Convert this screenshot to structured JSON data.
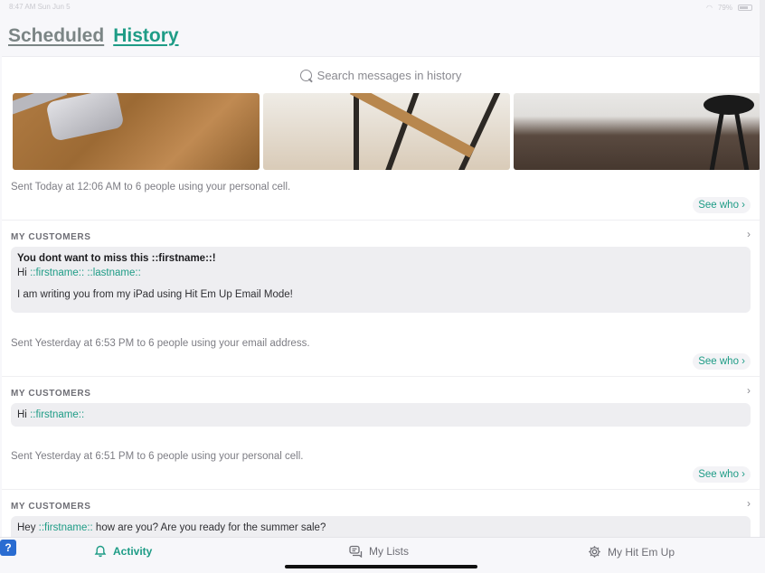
{
  "status_bar": {
    "time": "8:47 AM",
    "date": "Sun Jun 5",
    "battery": "79%"
  },
  "header": {
    "scheduled_label": "Scheduled",
    "history_label": "History"
  },
  "search": {
    "placeholder": "Search messages in history"
  },
  "entries": [
    {
      "sent": "Sent Today at 12:06 AM to 6 people using your personal cell.",
      "see_who": "See who ›"
    },
    {
      "list": "MY CUSTOMERS",
      "subject": "You dont want to miss this ::firstname::!",
      "greeting_prefix": "Hi ",
      "greeting_tags": "::firstname:: ::lastname::",
      "body": "I am writing you from my iPad using Hit Em Up Email Mode!",
      "sent": "Sent Yesterday at 6:53 PM to 6 people using your email address.",
      "see_who": "See who ›"
    },
    {
      "list": "MY CUSTOMERS",
      "greeting_prefix": "Hi ",
      "greeting_tags": "::firstname::",
      "sent": "Sent Yesterday at 6:51 PM to 6 people using your personal cell.",
      "see_who": "See who ›"
    },
    {
      "list": "MY CUSTOMERS",
      "greeting_prefix": "Hey ",
      "greeting_tags": "::firstname::",
      "greeting_suffix": " how are you? Are you ready for the summer sale?"
    }
  ],
  "tabbar": {
    "activity": "Activity",
    "my_lists": "My Lists",
    "my_hit_em_up": "My Hit Em Up"
  },
  "help_badge": "?",
  "colors": {
    "accent": "#1e9c86",
    "inactive_tab": "#7b8585",
    "bubble": "#eeeef1"
  }
}
